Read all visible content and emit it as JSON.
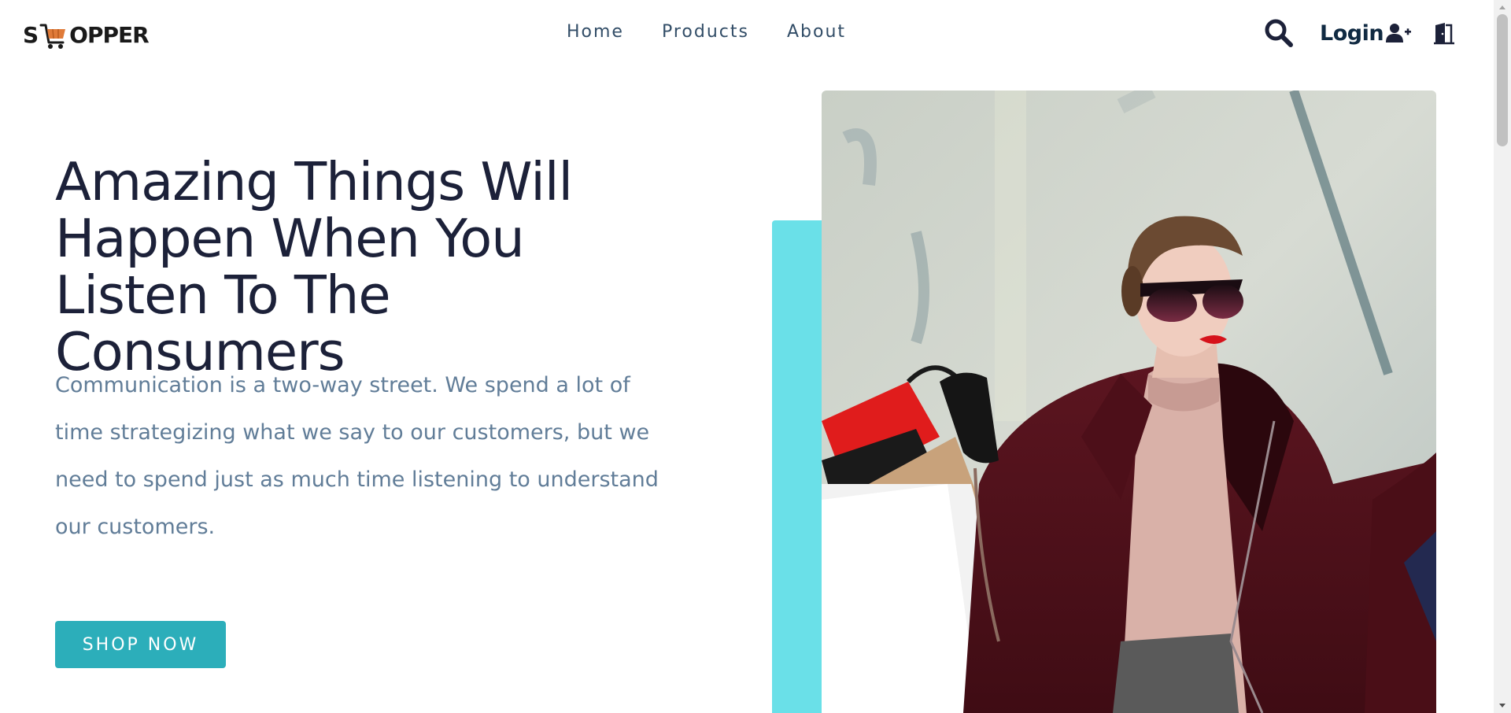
{
  "logo": {
    "text_left": "S",
    "text_right": "OPPER",
    "icon": "shopping-cart-icon"
  },
  "nav": {
    "links": [
      "Home",
      "Products",
      "About"
    ]
  },
  "header_actions": {
    "search_icon": "search-icon",
    "login_label": "Login",
    "signup_icon": "user-plus-icon",
    "logout_icon": "door-exit-icon"
  },
  "hero": {
    "title": "Amazing Things Will Happen When You Listen To The Consumers",
    "text": "Communication is a two-way street. We spend a lot of time strategizing what we say to our customers, but we need to spend just as much time listening to understand our customers.",
    "button_label": "SHOP NOW"
  },
  "colors": {
    "primary": "#2caeba",
    "accent": "#6ae0e8",
    "title": "#1c2139",
    "text": "#617d98",
    "nav_link": "#324d67"
  }
}
